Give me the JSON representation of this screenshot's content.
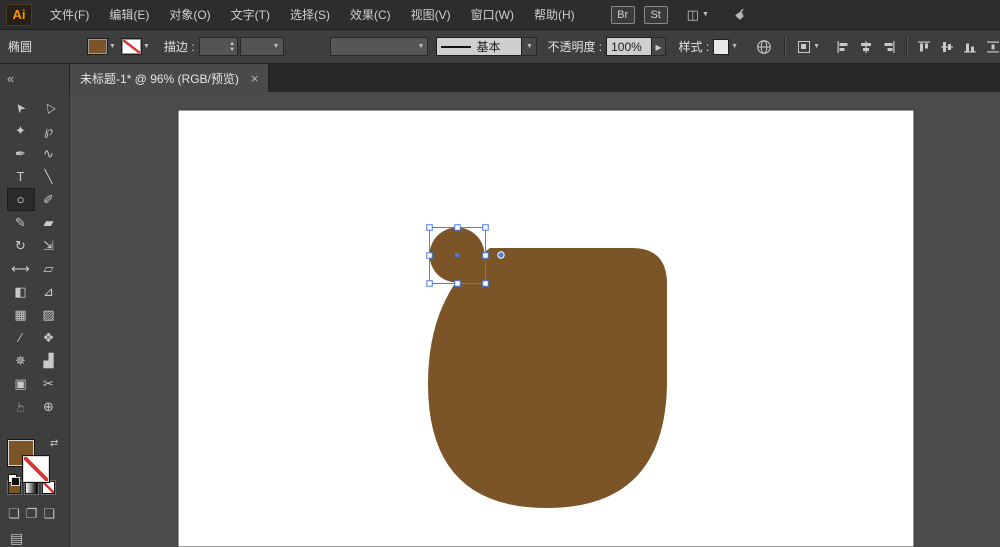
{
  "colors": {
    "artwork_brown": "#7b5527",
    "selection_blue": "#4a7ee0",
    "none_red": "#df3530",
    "accent_orange": "#f79500"
  },
  "menu_bar": {
    "logo": "Ai",
    "items": {
      "file": "文件(F)",
      "edit": "编辑(E)",
      "object": "对象(O)",
      "type": "文字(T)",
      "select": "选择(S)",
      "effect": "效果(C)",
      "view": "视图(V)",
      "window": "窗口(W)",
      "help": "帮助(H)"
    },
    "bridge": "Br",
    "stock": "St"
  },
  "control_bar": {
    "tool_name": "椭圆",
    "stroke_label": "描边 :",
    "stroke_weight": "",
    "stroke_type": "基本",
    "opacity_label": "不透明度 :",
    "opacity_value": "100%",
    "style_label": "样式 :"
  },
  "tab_bar": {
    "collapse": "«",
    "title": "未标题-1* @ 96% (RGB/预览)",
    "close": "×"
  },
  "tools": {
    "selection": "➤",
    "direct_selection": "▷",
    "magic_wand": "✦",
    "lasso": "℘",
    "pen": "✒",
    "curvature": "∿",
    "type": "T",
    "line": "╲",
    "ellipse": "○",
    "paintbrush": "✐",
    "pencil": "✎",
    "eraser": "▰",
    "rotate": "↻",
    "scale": "⇲",
    "width": "⟷",
    "free_transform": "▱",
    "shape_builder": "◧",
    "perspective": "⊿",
    "mesh": "▦",
    "gradient": "▨",
    "eyedropper": "∕",
    "blend": "❖",
    "symbol_sprayer": "✵",
    "graph": "▟",
    "artboard": "▣",
    "slice": "✂",
    "hand": "☞",
    "zoom": "⊕"
  },
  "toolbar_bottom": {
    "swap": "⇄",
    "draw_normal": "❏",
    "draw_behind": "❐",
    "draw_inside": "❑",
    "screen_mode": "▤"
  },
  "glyphs": {
    "dropdown": "▼",
    "stepper_up": "▲",
    "stepper_down": "▼",
    "chevron_right": "▸",
    "workspace": "◫",
    "hand_gesture": "☛"
  }
}
